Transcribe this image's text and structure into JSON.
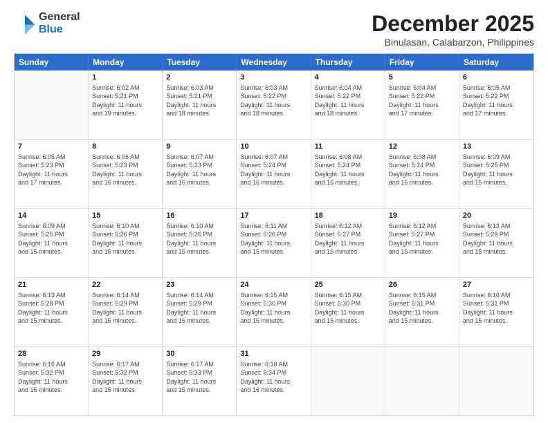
{
  "logo": {
    "general": "General",
    "blue": "Blue"
  },
  "title": "December 2025",
  "subtitle": "Binulasan, Calabarzon, Philippines",
  "headers": [
    "Sunday",
    "Monday",
    "Tuesday",
    "Wednesday",
    "Thursday",
    "Friday",
    "Saturday"
  ],
  "weeks": [
    [
      {
        "day": "",
        "info": ""
      },
      {
        "day": "1",
        "info": "Sunrise: 6:02 AM\nSunset: 5:21 PM\nDaylight: 11 hours\nand 19 minutes."
      },
      {
        "day": "2",
        "info": "Sunrise: 6:03 AM\nSunset: 5:21 PM\nDaylight: 11 hours\nand 18 minutes."
      },
      {
        "day": "3",
        "info": "Sunrise: 6:03 AM\nSunset: 5:22 PM\nDaylight: 11 hours\nand 18 minutes."
      },
      {
        "day": "4",
        "info": "Sunrise: 6:04 AM\nSunset: 5:22 PM\nDaylight: 11 hours\nand 18 minutes."
      },
      {
        "day": "5",
        "info": "Sunrise: 6:04 AM\nSunset: 5:22 PM\nDaylight: 11 hours\nand 17 minutes."
      },
      {
        "day": "6",
        "info": "Sunrise: 6:05 AM\nSunset: 5:22 PM\nDaylight: 11 hours\nand 17 minutes."
      }
    ],
    [
      {
        "day": "7",
        "info": "Sunrise: 6:05 AM\nSunset: 5:23 PM\nDaylight: 11 hours\nand 17 minutes."
      },
      {
        "day": "8",
        "info": "Sunrise: 6:06 AM\nSunset: 5:23 PM\nDaylight: 11 hours\nand 16 minutes."
      },
      {
        "day": "9",
        "info": "Sunrise: 6:07 AM\nSunset: 5:23 PM\nDaylight: 11 hours\nand 16 minutes."
      },
      {
        "day": "10",
        "info": "Sunrise: 6:07 AM\nSunset: 5:24 PM\nDaylight: 11 hours\nand 16 minutes."
      },
      {
        "day": "11",
        "info": "Sunrise: 6:08 AM\nSunset: 5:24 PM\nDaylight: 11 hours\nand 16 minutes."
      },
      {
        "day": "12",
        "info": "Sunrise: 6:08 AM\nSunset: 5:24 PM\nDaylight: 11 hours\nand 16 minutes."
      },
      {
        "day": "13",
        "info": "Sunrise: 6:09 AM\nSunset: 5:25 PM\nDaylight: 11 hours\nand 15 minutes."
      }
    ],
    [
      {
        "day": "14",
        "info": "Sunrise: 6:09 AM\nSunset: 5:25 PM\nDaylight: 11 hours\nand 15 minutes."
      },
      {
        "day": "15",
        "info": "Sunrise: 6:10 AM\nSunset: 5:26 PM\nDaylight: 11 hours\nand 15 minutes."
      },
      {
        "day": "16",
        "info": "Sunrise: 6:10 AM\nSunset: 5:26 PM\nDaylight: 11 hours\nand 15 minutes."
      },
      {
        "day": "17",
        "info": "Sunrise: 6:11 AM\nSunset: 5:26 PM\nDaylight: 11 hours\nand 15 minutes."
      },
      {
        "day": "18",
        "info": "Sunrise: 6:12 AM\nSunset: 5:27 PM\nDaylight: 11 hours\nand 15 minutes."
      },
      {
        "day": "19",
        "info": "Sunrise: 6:12 AM\nSunset: 5:27 PM\nDaylight: 11 hours\nand 15 minutes."
      },
      {
        "day": "20",
        "info": "Sunrise: 6:13 AM\nSunset: 5:28 PM\nDaylight: 11 hours\nand 15 minutes."
      }
    ],
    [
      {
        "day": "21",
        "info": "Sunrise: 6:13 AM\nSunset: 5:28 PM\nDaylight: 11 hours\nand 15 minutes."
      },
      {
        "day": "22",
        "info": "Sunrise: 6:14 AM\nSunset: 5:29 PM\nDaylight: 11 hours\nand 15 minutes."
      },
      {
        "day": "23",
        "info": "Sunrise: 6:14 AM\nSunset: 5:29 PM\nDaylight: 11 hours\nand 15 minutes."
      },
      {
        "day": "24",
        "info": "Sunrise: 6:15 AM\nSunset: 5:30 PM\nDaylight: 11 hours\nand 15 minutes."
      },
      {
        "day": "25",
        "info": "Sunrise: 6:15 AM\nSunset: 5:30 PM\nDaylight: 11 hours\nand 15 minutes."
      },
      {
        "day": "26",
        "info": "Sunrise: 6:15 AM\nSunset: 5:31 PM\nDaylight: 11 hours\nand 15 minutes."
      },
      {
        "day": "27",
        "info": "Sunrise: 6:16 AM\nSunset: 5:31 PM\nDaylight: 11 hours\nand 15 minutes."
      }
    ],
    [
      {
        "day": "28",
        "info": "Sunrise: 6:16 AM\nSunset: 5:32 PM\nDaylight: 11 hours\nand 15 minutes."
      },
      {
        "day": "29",
        "info": "Sunrise: 6:17 AM\nSunset: 5:32 PM\nDaylight: 11 hours\nand 15 minutes."
      },
      {
        "day": "30",
        "info": "Sunrise: 6:17 AM\nSunset: 5:33 PM\nDaylight: 11 hours\nand 15 minutes."
      },
      {
        "day": "31",
        "info": "Sunrise: 6:18 AM\nSunset: 5:34 PM\nDaylight: 11 hours\nand 16 minutes."
      },
      {
        "day": "",
        "info": ""
      },
      {
        "day": "",
        "info": ""
      },
      {
        "day": "",
        "info": ""
      }
    ]
  ]
}
